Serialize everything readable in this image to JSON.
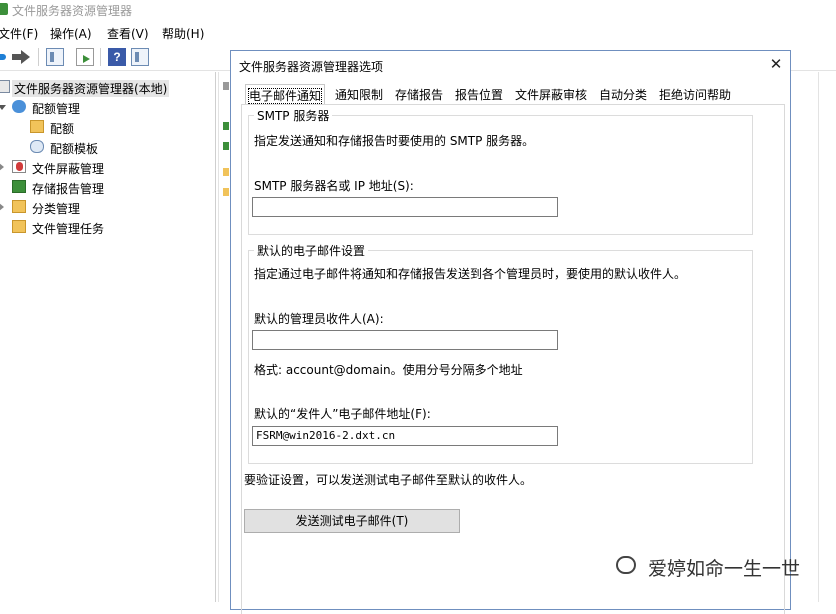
{
  "window": {
    "title": "文件服务器资源管理器"
  },
  "menubar": {
    "items": [
      "文件(F)",
      "操作(A)",
      "查看(V)",
      "帮助(H)"
    ]
  },
  "toolbar": {
    "icons": [
      "back-arrow-icon",
      "forward-arrow-icon",
      "show-hide-tree-icon",
      "export-list-icon",
      "help-icon",
      "properties-icon"
    ],
    "help_glyph": "?"
  },
  "tree": {
    "root": "文件服务器资源管理器(本地)",
    "quota_mgmt": "配额管理",
    "quota": "配额",
    "quota_template": "配额模板",
    "file_screen": "文件屏蔽管理",
    "storage_reports": "存储报告管理",
    "classification": "分类管理",
    "file_tasks": "文件管理任务"
  },
  "dialog": {
    "title": "文件服务器资源管理器选项",
    "close_glyph": "✕",
    "tabs": [
      "电子邮件通知",
      "通知限制",
      "存储报告",
      "报告位置",
      "文件屏蔽审核",
      "自动分类",
      "拒绝访问帮助"
    ],
    "active_tab": "电子邮件通知",
    "smtp": {
      "group_title": "SMTP 服务器",
      "description": "指定发送通知和存储报告时要使用的 SMTP 服务器。",
      "server_label": "SMTP 服务器名或 IP 地址(S):",
      "server_value": ""
    },
    "defaults": {
      "group_title": "默认的电子邮件设置",
      "description": "指定通过电子邮件将通知和存储报告发送到各个管理员时，要使用的默认收件人。",
      "admin_label": "默认的管理员收件人(A):",
      "admin_value": "",
      "format_hint": "格式: account@domain。使用分号分隔多个地址",
      "from_label": "默认的“发件人”电子邮件地址(F):",
      "from_value": "FSRM@win2016-2.dxt.cn"
    },
    "verify_text": "要验证设置，可以发送测试电子邮件至默认的收件人。",
    "send_test_button": "发送测试电子邮件(T)"
  },
  "watermark": {
    "text": "爱婷如命一生一世"
  },
  "colors": {
    "dialog_border": "#6f8fbf",
    "button_face": "#e1e1e1",
    "selection": "#e5e5e5"
  }
}
